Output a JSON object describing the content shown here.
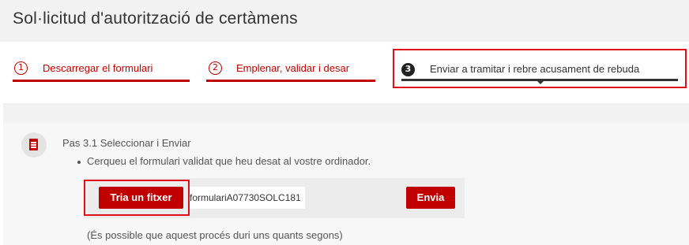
{
  "page": {
    "title": "Sol·licitud d'autorització de certàmens"
  },
  "steps": [
    {
      "number": "1",
      "label": "Descarregar el formulari",
      "active": false
    },
    {
      "number": "2",
      "label": "Emplenar, validar i desar",
      "active": false
    },
    {
      "number": "3",
      "label": "Enviar a tramitar i rebre acusament de rebuda",
      "active": true
    }
  ],
  "content": {
    "icon": "document-icon",
    "step_title": "Pas 3.1 Seleccionar i Enviar",
    "instruction": "Cerqueu el formulari validat que heu desat al vostre ordinador.",
    "choose_file_label": "Tria un fitxer",
    "file_name": "formulariA07730SOLC181",
    "send_label": "Envia",
    "note": "(És possible que aquest procés duri uns quants segons)"
  },
  "colors": {
    "accent": "#c00000",
    "highlight": "#e0101a",
    "active_step": "#222222"
  }
}
